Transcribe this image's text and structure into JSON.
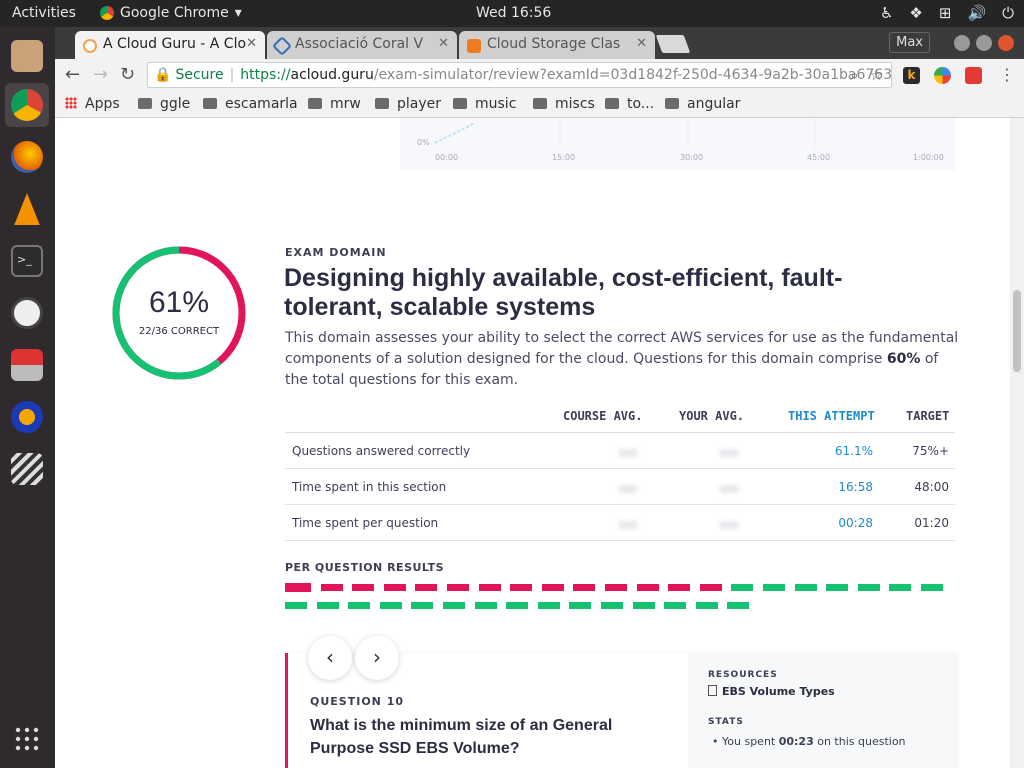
{
  "topbar": {
    "activities": "Activities",
    "app": "Google Chrome",
    "clock": "Wed 16:56"
  },
  "browser": {
    "tabs": [
      {
        "title": "A Cloud Guru - A Clo"
      },
      {
        "title": "Associació Coral V"
      },
      {
        "title": "Cloud Storage Clas"
      }
    ],
    "window_label": "Max",
    "url": {
      "secure_label": "Secure",
      "scheme": "https://",
      "host": "acloud.guru",
      "path": "/exam-simulator/review?examId=03d1842f-250d-4634-9a2b-30a1ba6763f..."
    },
    "bookmarks": [
      "Apps",
      "ggle",
      "escamarla",
      "mrw",
      "player",
      "music",
      "miscs",
      "to...",
      "angular"
    ]
  },
  "chart_remnant": {
    "ylabel": "0%",
    "ticks": [
      "00:00",
      "15:00",
      "30:00",
      "45:00",
      "1:00:00"
    ]
  },
  "domain": {
    "score_pct": "61%",
    "score_sub": "22/36 CORRECT",
    "score_fraction": 0.61,
    "label": "EXAM DOMAIN",
    "title": "Designing highly available, cost-efficient, fault-tolerant, scalable systems",
    "desc_part1": "This domain assesses your ability to select the correct AWS services for use as the fundamental components of a solution designed for the cloud. Questions for this domain comprise ",
    "desc_bold": "60%",
    "desc_part2": " of the total questions for this exam."
  },
  "stats": {
    "headers": {
      "course": "COURSE AVG.",
      "yours": "YOUR AVG.",
      "attempt": "THIS ATTEMPT",
      "target": "TARGET"
    },
    "rows": [
      {
        "label": "Questions answered correctly",
        "attempt": "61.1%",
        "target": "75%+"
      },
      {
        "label": "Time spent in this section",
        "attempt": "16:58",
        "target": "48:00"
      },
      {
        "label": "Time spent per question",
        "attempt": "00:28",
        "target": "01:20"
      }
    ]
  },
  "per_question": {
    "label": "PER QUESTION RESULTS",
    "results": [
      "wrong",
      "wrong",
      "wrong",
      "wrong",
      "wrong",
      "wrong",
      "wrong",
      "wrong",
      "wrong",
      "wrong",
      "wrong",
      "wrong",
      "wrong",
      "wrong",
      "correct",
      "correct",
      "correct",
      "correct",
      "correct",
      "correct",
      "correct",
      "correct",
      "correct",
      "correct",
      "correct",
      "correct",
      "correct",
      "correct",
      "correct",
      "correct",
      "correct",
      "correct",
      "correct",
      "correct",
      "correct",
      "correct"
    ],
    "colors": {
      "wrong": "#e2145a",
      "correct": "#16c172"
    }
  },
  "question": {
    "label": "QUESTION 10",
    "text": "What is the minimum size of an General Purpose SSD EBS Volume?",
    "resources_label": "RESOURCES",
    "resource_link": "EBS Volume Types",
    "stats_label": "STATS",
    "stat_prefix": "You spent ",
    "stat_bold": "00:23",
    "stat_suffix": " on this question"
  },
  "colors": {
    "accent_pink": "#e2145a",
    "accent_green": "#16c172",
    "link_blue": "#1f8bd0"
  }
}
